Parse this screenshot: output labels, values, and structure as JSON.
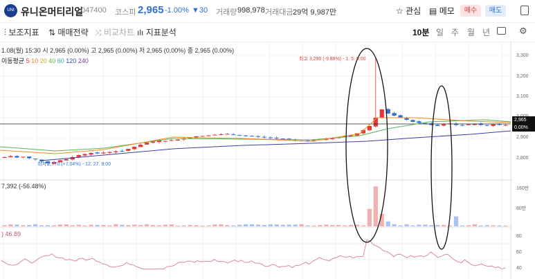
{
  "header": {
    "logo_text": "UNI",
    "stock_name": "유니온머티리얼",
    "code": "047400",
    "market": "코스피",
    "change_arrow": "▼",
    "price": "2,965",
    "change_pct": "-1.00%",
    "change_amount": "▼30",
    "volume_label": "거래량",
    "volume_value": "998,978",
    "amount_label": "거래대금",
    "amount_value": "29억 9,987만",
    "fav_label": "관심",
    "memo_label": "메모",
    "buy_label": "매수",
    "sell_label": "매도"
  },
  "toolbar": {
    "aux_indicator": "보조지표",
    "strategy": "매매전략",
    "compare": "비교차트",
    "analysis": "지표분석",
    "periods": [
      "10분",
      "일",
      "주",
      "월",
      "년"
    ],
    "active_period": "10분"
  },
  "ohlc_info": "1.08(월) 15:30  시 2,965 (0.00%)  고 2,965 (0.00%)  저 2,965 (0.00%)  종 2,965 (0.00%)",
  "ma": {
    "label": "이동평균",
    "periods": [
      "5",
      "10",
      "20",
      "40",
      "60",
      "120",
      "240"
    ],
    "colors": [
      "#e03a3a",
      "#f08c1a",
      "#c9b21a",
      "#58b35a",
      "#3aa6a6",
      "#2a4fa8",
      "#6a3fa8"
    ]
  },
  "annotations": {
    "high": "최고 3,290 (-9.88%) - 1. 5. 9:00",
    "low": "최저 2,770 (+7.04%) - 12. 27. 9:00"
  },
  "price_axis": [
    "3,300",
    "3,200",
    "3,100",
    "3,000",
    "2,900",
    "2,800"
  ],
  "price_tag": {
    "price": "2,965",
    "pct": "0.00%"
  },
  "volume_info": "7,392 (-56.48%)",
  "volume_axis": [
    "160만",
    "80만"
  ],
  "rsi_info": "46.89",
  "rsi_axis": [
    "80",
    "60",
    "40"
  ],
  "colors": {
    "up": "#e03a3a",
    "down": "#2f6fd6",
    "accent": "#2f6fd6"
  },
  "chart_data": {
    "type": "candlestick",
    "price_ylim": [
      2700,
      3350
    ],
    "close": [
      2810,
      2815,
      2808,
      2812,
      2805,
      2800,
      2790,
      2780,
      2785,
      2795,
      2800,
      2810,
      2820,
      2825,
      2830,
      2828,
      2832,
      2835,
      2838,
      2840,
      2850,
      2860,
      2870,
      2880,
      2885,
      2890,
      2888,
      2892,
      2895,
      2900,
      2905,
      2910,
      2912,
      2915,
      2918,
      2920,
      2922,
      2918,
      2915,
      2912,
      2910,
      2908,
      2905,
      2903,
      2900,
      2898,
      2895,
      2892,
      2890,
      2888,
      2892,
      2895,
      2898,
      2900,
      2905,
      2910,
      2915,
      2925,
      2940,
      2960,
      3000,
      3040,
      3020,
      3010,
      3000,
      2990,
      2980,
      2975,
      2970,
      2965,
      2960,
      2968,
      2972,
      2965,
      2962,
      2968,
      2970,
      2965,
      2962,
      2968,
      2966,
      2965
    ],
    "volume_ylim": [
      0,
      1800000
    ],
    "rsi_ylim": [
      30,
      90
    ]
  }
}
